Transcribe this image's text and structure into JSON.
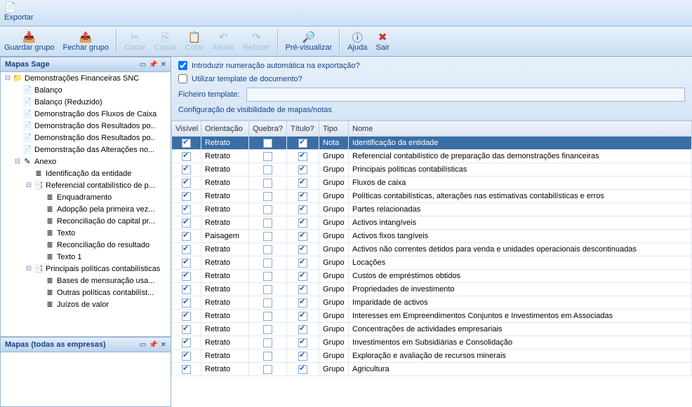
{
  "topbar": {
    "label": "Exportar"
  },
  "toolbar": {
    "guardar": "Guardar grupo",
    "fechar": "Fechar grupo",
    "cortar": "Cortar",
    "copiar": "Copiar",
    "colar": "Colar",
    "anular": "Anular",
    "refazer": "Refazer",
    "previsualizar": "Pré-visualizar",
    "ajuda": "Ajuda",
    "sair": "Sair"
  },
  "sidebar": {
    "header1": "Mapas Sage",
    "header2": "Mapas (todas as empresas)",
    "tree": {
      "root": "Demonstrações Financeiras SNC",
      "items": [
        "Balanço",
        "Balanço (Reduzido)",
        "Demonstração dos Fluxos de Caixa",
        "Demonstração dos Resultados po..",
        "Demonstração dos Resultados po..",
        "Demonstração das Alterações no..."
      ],
      "anexo": "Anexo",
      "anexo_items": {
        "ident": "Identificação da entidade",
        "refer": "Referencial contabilístico de p...",
        "refer_children": [
          "Enquadramento",
          "Adopção pela primeira vez...",
          "Reconciliação do capital pr...",
          "Texto",
          "Reconciliação do resultado",
          "Texto 1"
        ],
        "princ": "Principais políticas contabilísticas",
        "princ_children": [
          "Bases de mensuração usa...",
          "Outras políticas contabilíst...",
          "Juízos de valor"
        ]
      }
    }
  },
  "options": {
    "auto_num": "Introduzir numeração automática na exportação?",
    "use_template": "Utilizar template de documento?",
    "file_label": "Ficheiro template:",
    "config_label": "Configuração de visibilidade de mapas/notas"
  },
  "grid": {
    "headers": {
      "vis": "Visível",
      "ori": "Orientação",
      "qbr": "Quebra?",
      "tit": "Título?",
      "tipo": "Tipo",
      "nome": "Nome"
    },
    "rows": [
      {
        "vis": true,
        "ori": "Retrato",
        "qbr": false,
        "tit": true,
        "tipo": "Nota",
        "nome": "Identificação da entidade",
        "sel": true
      },
      {
        "vis": true,
        "ori": "Retrato",
        "qbr": false,
        "tit": true,
        "tipo": "Grupo",
        "nome": "Referencial contabilístico de preparação das demonstrações financeiras"
      },
      {
        "vis": true,
        "ori": "Retrato",
        "qbr": false,
        "tit": true,
        "tipo": "Grupo",
        "nome": "Principais políticas contabilísticas"
      },
      {
        "vis": true,
        "ori": "Retrato",
        "qbr": false,
        "tit": true,
        "tipo": "Grupo",
        "nome": "Fluxos de caixa"
      },
      {
        "vis": true,
        "ori": "Retrato",
        "qbr": false,
        "tit": true,
        "tipo": "Grupo",
        "nome": "Políticas contabilísticas, alterações nas estimativas contabilísticas e erros"
      },
      {
        "vis": true,
        "ori": "Retrato",
        "qbr": false,
        "tit": true,
        "tipo": "Grupo",
        "nome": "Partes relacionadas"
      },
      {
        "vis": true,
        "ori": "Retrato",
        "qbr": false,
        "tit": true,
        "tipo": "Grupo",
        "nome": "Activos intangíveis"
      },
      {
        "vis": true,
        "ori": "Paisagem",
        "qbr": false,
        "tit": true,
        "tipo": "Grupo",
        "nome": "Activos fixos tangíveis"
      },
      {
        "vis": true,
        "ori": "Retrato",
        "qbr": false,
        "tit": true,
        "tipo": "Grupo",
        "nome": "Activos não correntes detidos para venda e unidades operacionais descontinuadas"
      },
      {
        "vis": true,
        "ori": "Retrato",
        "qbr": false,
        "tit": true,
        "tipo": "Grupo",
        "nome": "Locações"
      },
      {
        "vis": true,
        "ori": "Retrato",
        "qbr": false,
        "tit": true,
        "tipo": "Grupo",
        "nome": "Custos de empréstimos obtidos"
      },
      {
        "vis": true,
        "ori": "Retrato",
        "qbr": false,
        "tit": true,
        "tipo": "Grupo",
        "nome": "Propriedades de investimento"
      },
      {
        "vis": true,
        "ori": "Retrato",
        "qbr": false,
        "tit": true,
        "tipo": "Grupo",
        "nome": "Imparidade de activos"
      },
      {
        "vis": true,
        "ori": "Retrato",
        "qbr": false,
        "tit": true,
        "tipo": "Grupo",
        "nome": "Interesses em Empreendimentos Conjuntos e Investimentos em Associadas"
      },
      {
        "vis": true,
        "ori": "Retrato",
        "qbr": false,
        "tit": true,
        "tipo": "Grupo",
        "nome": "Concentrações de actividades empresariais"
      },
      {
        "vis": true,
        "ori": "Retrato",
        "qbr": false,
        "tit": true,
        "tipo": "Grupo",
        "nome": "Investimentos em Subsidiárias e Consolidação"
      },
      {
        "vis": true,
        "ori": "Retrato",
        "qbr": false,
        "tit": true,
        "tipo": "Grupo",
        "nome": "Exploração e avaliação de recursos minerais"
      },
      {
        "vis": true,
        "ori": "Retrato",
        "qbr": false,
        "tit": true,
        "tipo": "Grupo",
        "nome": "Agricultura"
      }
    ]
  }
}
